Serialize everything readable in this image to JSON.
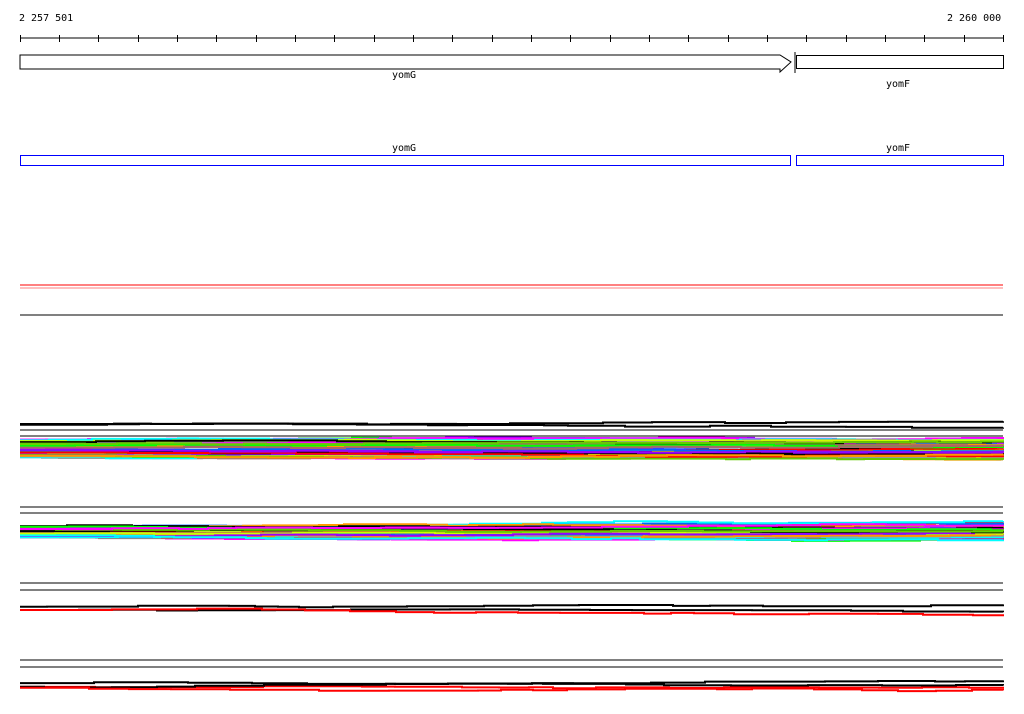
{
  "ruler": {
    "start_label": "2 257 501",
    "end_label": "2 260 000",
    "start": 2257501,
    "end": 2260000,
    "tick_step": 100
  },
  "genes_top": [
    {
      "name": "yomG",
      "strand": "+",
      "start": 2257501,
      "end": 2259461
    },
    {
      "name": "yomF",
      "strand": "",
      "start": 2259474,
      "end": 2260000
    }
  ],
  "genes_bottom": [
    {
      "name": "yomG",
      "color": "#0000ff"
    },
    {
      "name": "yomF",
      "color": "#0000ff"
    }
  ],
  "colors": {
    "axis": "#000000",
    "gene_box": "#0000ff",
    "signal_red": "#ff0000"
  }
}
